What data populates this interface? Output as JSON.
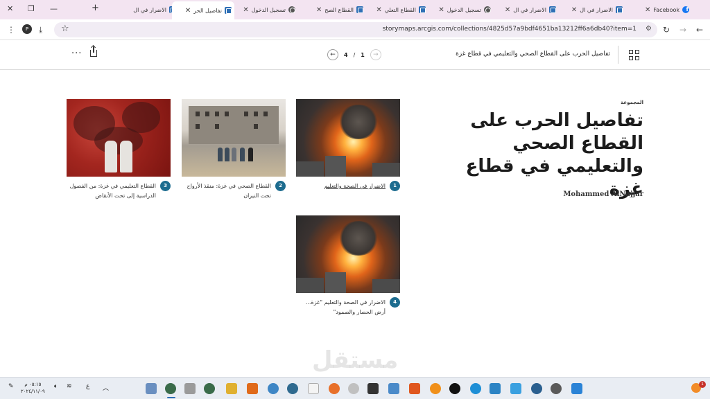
{
  "browser": {
    "tabs": [
      {
        "label": "Facebook",
        "icon": "facebook-icon"
      },
      {
        "label": "الاضرار في ال",
        "icon": "storymaps-icon"
      },
      {
        "label": "الاضرار في ال",
        "icon": "storymaps-icon"
      },
      {
        "label": "تسجيل الدخول",
        "icon": "globe-icon"
      },
      {
        "label": "القطاع التعلي",
        "icon": "storymaps-icon"
      },
      {
        "label": "القطاع الصح",
        "icon": "storymaps-icon"
      },
      {
        "label": "تسجيل الدخول",
        "icon": "globe-icon"
      },
      {
        "label": "تفاصيل الحر",
        "icon": "storymaps-icon",
        "active": true
      },
      {
        "label": "الاضرار في ال",
        "icon": "storymaps-icon"
      }
    ],
    "new_tab": "+",
    "url": "storymaps.arcgis.com/collections/4825d57a9bdf4651ba13212ff6a6db40?item=1",
    "profile_initial": "P"
  },
  "story_header": {
    "title": "تفاصيل الحرب على القطاع الصحي والتعليمي في قطاع غزة",
    "pager_current": "1",
    "pager_sep": "/",
    "pager_total": "4"
  },
  "collection": {
    "label": "المجموعة",
    "title": "تفاصيل الحرب على القطاع الصحي والتعليمي في قطاع غزة",
    "author": "Mohammed AlNajjar"
  },
  "cards": [
    {
      "number": "1",
      "caption": "الاضرار في الصحة والتعليم",
      "image": "explosion-image"
    },
    {
      "number": "2",
      "caption": "القطاع الصحي في غزة: منقذ الأرواح تحت النيران",
      "image": "ruined-hospital-image"
    },
    {
      "number": "3",
      "caption": "القطاع التعليمي في غزة: من الفصول الدراسية إلى تحت الأنقاض",
      "image": "red-smoke-image"
    },
    {
      "number": "4",
      "caption": "الاضرار في الصحة والتعليم \"غزة... أرض الحصار والصمود\"",
      "image": "explosion-image"
    }
  ],
  "watermark": "مستقل",
  "taskbar": {
    "time": "٠٥:١٥ م",
    "date": "٢٠٢٤/١١/٠٩",
    "lang": "ع",
    "notification_count": "1"
  },
  "colors": {
    "accent": "#1d6c8f",
    "tabstrip": "#f3e4f1"
  }
}
